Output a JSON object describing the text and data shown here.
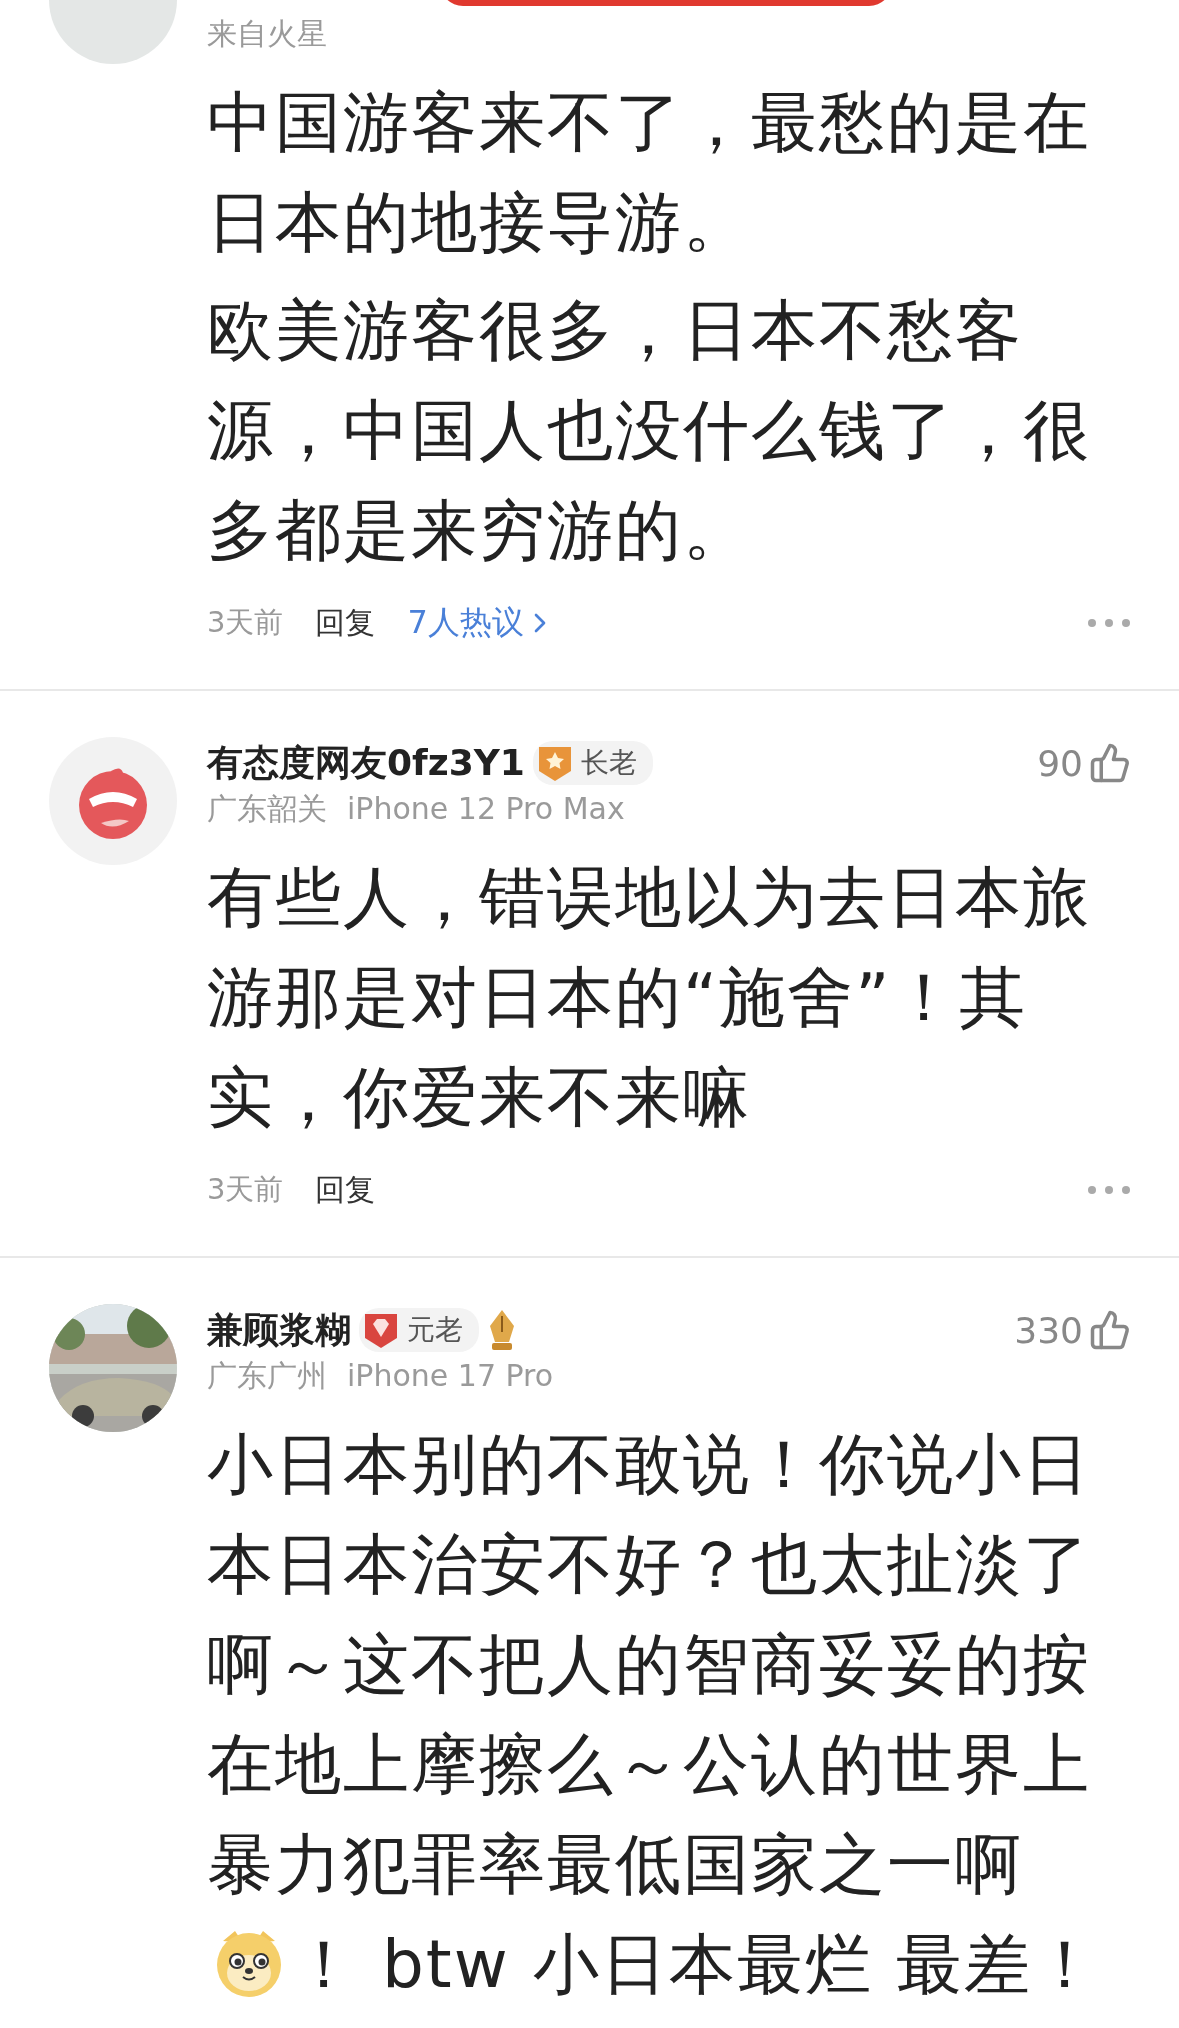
{
  "comments": [
    {
      "avatar": {
        "kind": "blank"
      },
      "location": "来自火星",
      "paragraphs": [
        [
          {
            "kind": "text",
            "text": "中国游客来不了，最愁的是在日本的地接导游。"
          }
        ],
        [
          {
            "kind": "text",
            "text": "欧美游客很多，日本不愁客源，中国人也没什么钱了，很多都是来穷游的。"
          }
        ]
      ],
      "time": "3天前",
      "reply": "回复",
      "discussion": "7人热议"
    },
    {
      "avatar": {
        "kind": "logo"
      },
      "name": "有态度网友0fz3Y1",
      "badge": {
        "kind": "star",
        "label": "长老"
      },
      "location": "广东韶关",
      "device": "iPhone 12 Pro Max",
      "likes": "90",
      "paragraphs": [
        [
          {
            "kind": "text",
            "text": "有些人，错误地以为去日本旅游那是对日本的“施舍”！其实，你爱来不来嘛"
          }
        ]
      ],
      "time": "3天前",
      "reply": "回复"
    },
    {
      "avatar": {
        "kind": "picture"
      },
      "name": "兼顾浆糊",
      "badge": {
        "kind": "gem",
        "label": "元老"
      },
      "medal": true,
      "location": "广东广州",
      "device": "iPhone 17 Pro",
      "likes": "330",
      "paragraphs": [
        [
          {
            "kind": "text",
            "text": "小日本别的不敢说！你说小日本日本治安不好？也太扯淡了啊～这不把人的智商妥妥的按在地上摩擦么～公认的世界上暴力犯罪率最低国家之一啊"
          },
          {
            "kind": "emoji"
          },
          {
            "kind": "text",
            "text": "！ btw 小日本最烂 最差！"
          }
        ]
      ]
    }
  ]
}
